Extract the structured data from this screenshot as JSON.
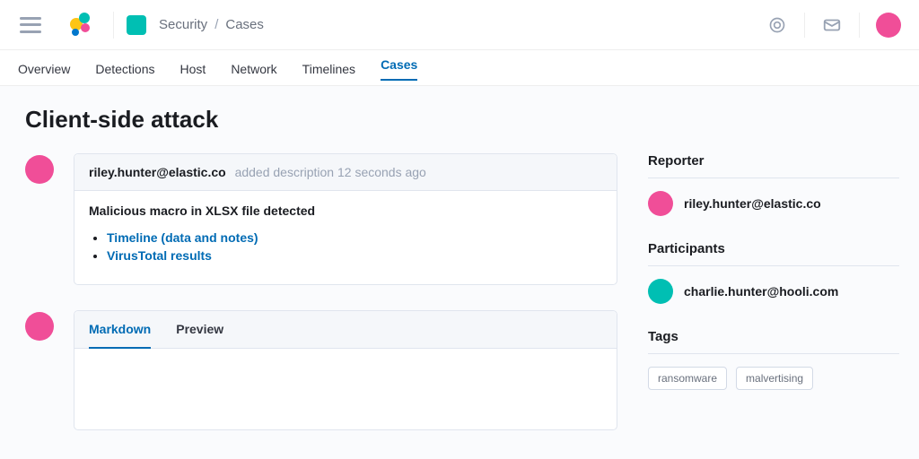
{
  "breadcrumb": {
    "root": "Security",
    "current": "Cases"
  },
  "nav": {
    "overview": "Overview",
    "detections": "Detections",
    "host": "Host",
    "network": "Network",
    "timelines": "Timelines",
    "cases": "Cases"
  },
  "case": {
    "title": "Client-side attack"
  },
  "activity": {
    "entry1": {
      "actor": "riley.hunter@elastic.co",
      "action": "added description",
      "time": "12 seconds ago",
      "description": "Malicious macro in XLSX file detected",
      "link_timeline": "Timeline (data and notes)",
      "link_virustotal": "VirusTotal results"
    },
    "editor": {
      "tab_markdown": "Markdown",
      "tab_preview": "Preview"
    }
  },
  "sidebar": {
    "reporter_label": "Reporter",
    "reporter_name": "riley.hunter@elastic.co",
    "participants_label": "Participants",
    "participant1_name": "charlie.hunter@hooli.com",
    "tags_label": "Tags",
    "tag1": "ransomware",
    "tag2": "malvertising"
  }
}
